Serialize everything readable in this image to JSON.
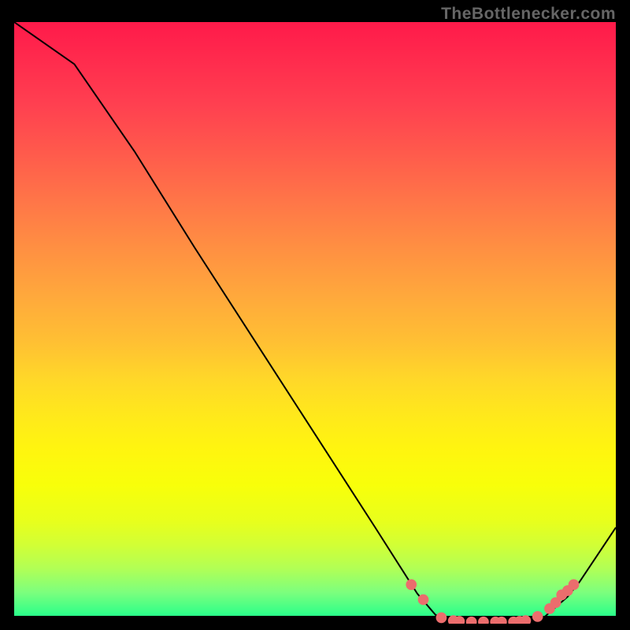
{
  "watermark": "TheBottlenecker.com",
  "chart_data": {
    "type": "line",
    "title": "",
    "xlabel": "",
    "ylabel": "",
    "xlim": [
      0,
      100
    ],
    "ylim": [
      0,
      100
    ],
    "x": [
      0,
      10,
      20,
      30,
      40,
      50,
      60,
      67,
      70,
      72,
      76,
      80,
      84,
      88,
      92,
      94,
      100
    ],
    "values": [
      100,
      93,
      78.5,
      62.5,
      47,
      31.5,
      16,
      5,
      1.5,
      0.4,
      0.2,
      0.2,
      0.3,
      1.0,
      4.5,
      7,
      16
    ],
    "markers_x": [
      66,
      68,
      71,
      73,
      74,
      76,
      78,
      80,
      81,
      83,
      84,
      85,
      87,
      89,
      90,
      91,
      92,
      93
    ],
    "markers_y": [
      6.5,
      4,
      1,
      0.5,
      0.4,
      0.3,
      0.3,
      0.3,
      0.3,
      0.3,
      0.4,
      0.5,
      1.2,
      2.5,
      3.5,
      4.8,
      5.5,
      6.5
    ],
    "marker_color": "#eb6d6d",
    "line_color": "#000000"
  }
}
